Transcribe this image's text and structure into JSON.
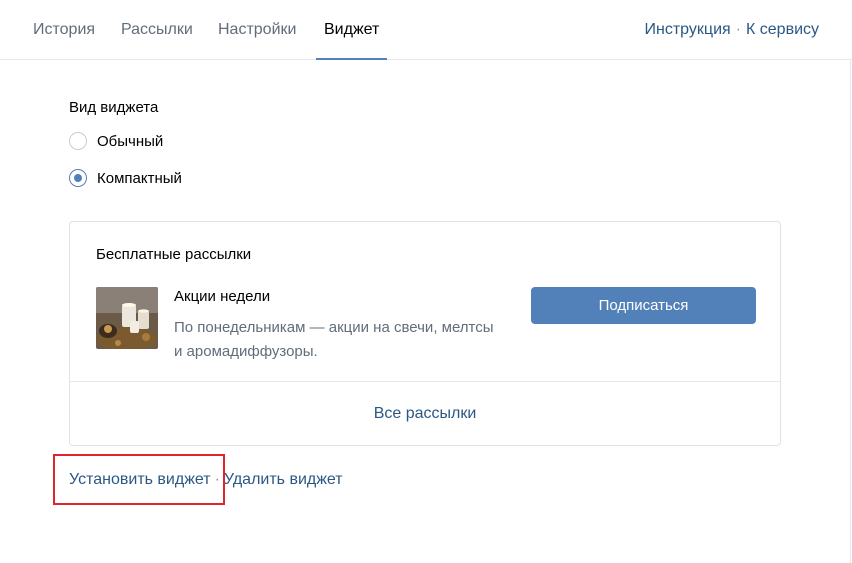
{
  "tabs": [
    {
      "label": "История"
    },
    {
      "label": "Рассылки"
    },
    {
      "label": "Настройки"
    },
    {
      "label": "Виджет"
    }
  ],
  "header_links": {
    "instructions": "Инструкция",
    "separator": "·",
    "to_service": "К сервису"
  },
  "widget_type": {
    "label": "Вид виджета",
    "options": [
      {
        "label": "Обычный",
        "selected": false
      },
      {
        "label": "Компактный",
        "selected": true
      }
    ]
  },
  "preview": {
    "title": "Бесплатные рассылки",
    "item": {
      "title": "Акции недели",
      "description": "По понедельникам — акции на свечи, мелтсы и аромадиффузоры.",
      "thumbnail_icon": "candles-image"
    },
    "subscribe_label": "Подписаться",
    "all_label": "Все рассылки"
  },
  "actions": {
    "install": "Установить виджет",
    "separator": "·",
    "remove": "Удалить виджет"
  },
  "colors": {
    "accent": "#5181b8",
    "link": "#2a5885",
    "muted": "#626d7a",
    "highlight": "#e0242b"
  }
}
